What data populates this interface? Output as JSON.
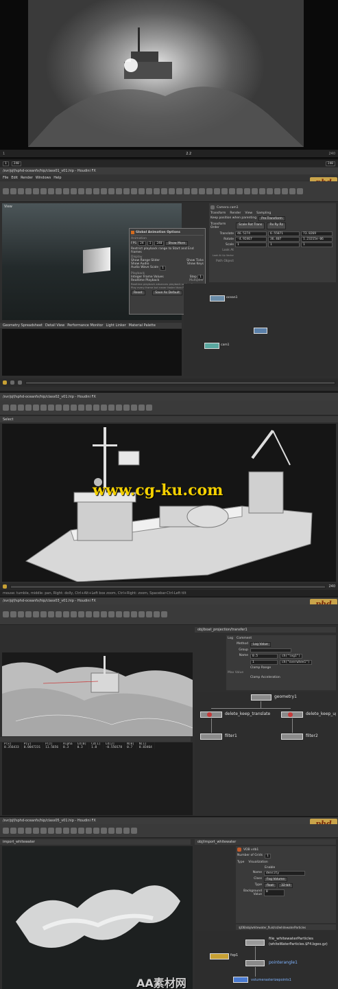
{
  "render": {
    "timeline_frames": [
      "1",
      "240"
    ],
    "overlay_text": [
      "2.2"
    ]
  },
  "panel2": {
    "title": "/svr/pjf/sphd-oceanfx/hip/class01_v01.hip - Houdini FX",
    "menus": [
      "File",
      "Edit",
      "Render",
      "Windows",
      "Help"
    ],
    "frame_range": [
      "1",
      "240"
    ],
    "end_frame": "240",
    "viewport_label": "View",
    "dialog": {
      "title": "Global Animation Options",
      "animation_label": "Animation",
      "fps_label": "FPS",
      "fps": "24",
      "start": "1",
      "end": "240",
      "show_more": "Show More",
      "restrict": "Restrict playback range to Start and End frames",
      "display_label": "Display",
      "show_range_slider": "Show Range Slider",
      "show_ticks": "Show Ticks",
      "show_audio": "Show Audio",
      "show_keys": "Show Keys",
      "audio_scale_label": "Audio Wave Scale",
      "audio_scale": "1",
      "playback_label": "Playback",
      "integer_frames": "Integer Frame Values",
      "step_label": "Step",
      "step": "1",
      "realtime": "Realtime Playback",
      "multiplier_label": "Multiplier",
      "realtime_note": "Realtime playback advances playback setting/frames",
      "play_every": "Play every frame but never faster than FPS",
      "buttons": [
        "Reset",
        "Save As Default",
        "Close"
      ]
    },
    "param": {
      "title": "Camera cam1",
      "tabs": [
        "Transform",
        "Render",
        "View",
        "Sampling"
      ],
      "keep_pos": "Keep position when parenting",
      "keep_pos_val": "Pre-Transform",
      "order_label": "Transform Order",
      "order": "Scale Rot Trans",
      "rot_order": "Rx Ry Rz",
      "rows": [
        {
          "label": "Translate",
          "v": [
            "46.5274",
            "6.55871",
            "73.8269"
          ]
        },
        {
          "label": "Rotate",
          "v": [
            "-4.92467",
            "36.407",
            "1.23215e-06"
          ]
        },
        {
          "label": "Scale",
          "v": [
            "1",
            "1",
            "1"
          ]
        },
        {
          "label": "Look At",
          "v": []
        },
        {
          "label": "Look At Up Vector",
          "v": []
        },
        {
          "label": "Path Object",
          "v": []
        }
      ]
    },
    "tabs": [
      "Geometry Spreadsheet",
      "Detail View",
      "Performance Monitor",
      "Light Linker",
      "Material Palette"
    ],
    "nodes": [
      "ocean1",
      "cam1"
    ]
  },
  "panel3": {
    "title": "/svr/pjf/sphd-oceanfx/hip/class02_v01.hip - Houdini FX",
    "viewport_label": "Select",
    "frame": "240",
    "status_text": "mouse: tumble, middle: pan, Right: dolly, Ctrl+Alt+Left box zoom, Ctrl+Right: zoom, Spacebar-Ctrl-Left tilt"
  },
  "panel4": {
    "title": "/svr/pjf/sphd-oceanfx/hip/class03_v01.hip - Houdini FX",
    "network_path": "obj/boat_projection/transfer1",
    "param_tabs": [
      "Log",
      "Comment"
    ],
    "method_label": "Method",
    "method": "Log Value",
    "group_label": "Group",
    "name_label": "Name",
    "row_a": {
      "val": "0.5",
      "expr": "ch(\"log1\")"
    },
    "row_b": {
      "val": "1",
      "expr": "ch(\"overwhee1\")"
    },
    "clamp_range": "Clamp Range",
    "max_value_label": "Max Value",
    "clamp_acc": "Clamp Acceleration",
    "spreadsheet": {
      "headers": [
        "P[x]",
        "P[y]",
        "P[z]",
        "Alpha",
        "Cd[0]",
        "Cd[1]",
        "Cd[2]",
        "N[0]",
        "N[1]"
      ],
      "row": [
        "0.356433",
        "0.0047231",
        "11.5656",
        "0.3",
        "0.3",
        "1.0",
        "-0.550178",
        "0.7",
        "0.83464"
      ]
    },
    "nodes": {
      "geometry": "geometry1",
      "dl": "delete_keep_translate",
      "dr": "delete_keep_up",
      "fl": "filter1",
      "fr": "filter2"
    }
  },
  "panel5": {
    "title": "/svr/pjf/sphd-oceanfx/hip/class05_v01.hip - Houdini FX",
    "viewport_tab": "import_whitewater",
    "network_path": "obj/import_whitewater",
    "param_title": "VDB vdb1",
    "voxel_label": "Number of Grids",
    "voxel": "1",
    "type_tab": "Type",
    "visual_tab": "Visualization",
    "enable": "Enable",
    "name_label": "Name",
    "name": "density",
    "class_label": "Class",
    "class": "Fog Volume",
    "type_label": "Type",
    "type": "float",
    "type_size": "32-bit",
    "bg_label": "Background Value",
    "bg": "0",
    "file_path": "$JOB/obj/whitewater_fluid/cd/whitewaterParticles",
    "nodes": {
      "file": "file_whitewaterParticles",
      "file_sub": "(whiteWaterParticles.$F4.bgeo.gz)",
      "pointer": "pointerangle1",
      "volume": "volumerasterizepoints1",
      "left": "fop1"
    }
  },
  "watermarks": {
    "top": "www.cg-ku.com",
    "bottom": "AA素材网"
  },
  "logo": "phd"
}
